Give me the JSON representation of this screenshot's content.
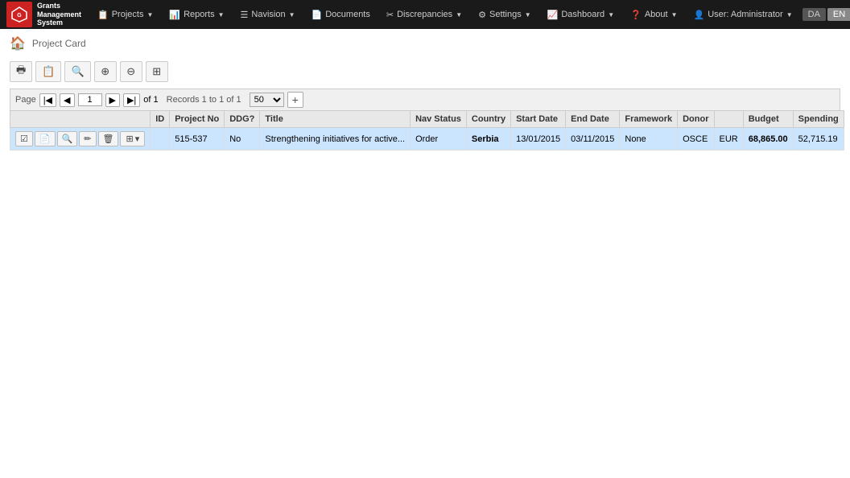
{
  "navbar": {
    "brand": {
      "line1": "Grants",
      "line2": "Management",
      "line3": "System"
    },
    "items": [
      {
        "label": "Projects",
        "icon": "📋"
      },
      {
        "label": "Reports",
        "icon": "📊"
      },
      {
        "label": "Navision",
        "icon": "☰"
      },
      {
        "label": "Documents",
        "icon": "📄"
      },
      {
        "label": "Discrepancies",
        "icon": "✂"
      },
      {
        "label": "Settings",
        "icon": "⚙"
      },
      {
        "label": "Dashboard",
        "icon": "📈"
      },
      {
        "label": "About",
        "icon": "❓"
      },
      {
        "label": "User: Administrator",
        "icon": "👤"
      }
    ],
    "lang_da": "DA",
    "lang_en": "EN"
  },
  "breadcrumb": {
    "home_icon": "🏠",
    "tab_label": "Project Card"
  },
  "toolbar": {
    "print_label": "🖶",
    "print2_label": "⊟",
    "search_label": "🔍",
    "zoom_in_label": "🔍+",
    "zoom_out_label": "🔍-",
    "filter_label": "⊞"
  },
  "pagination": {
    "page_label": "Page",
    "current_page": "1",
    "of_label": "of 1",
    "records_text": "Records 1 to 1 of 1",
    "per_page": "50",
    "add_icon": "+"
  },
  "table": {
    "columns": [
      "ID",
      "Project No",
      "DDG?",
      "Title",
      "Nav Status",
      "Country",
      "Start Date",
      "End Date",
      "Framework",
      "Donor",
      "",
      "Budget",
      "Spending"
    ],
    "rows": [
      {
        "id": "",
        "project_no": "515-537",
        "ddg": "No",
        "title": "Strengthening initiatives for active...",
        "nav_status": "Order",
        "country": "Serbia",
        "start_date": "13/01/2015",
        "end_date": "03/11/2015",
        "framework": "None",
        "donor": "OSCE",
        "currency": "EUR",
        "budget": "68,865.00",
        "spending": "52,715.19"
      }
    ],
    "row_actions": [
      "📄",
      "🔍",
      "✏",
      "🗑",
      "⊞▾"
    ]
  }
}
